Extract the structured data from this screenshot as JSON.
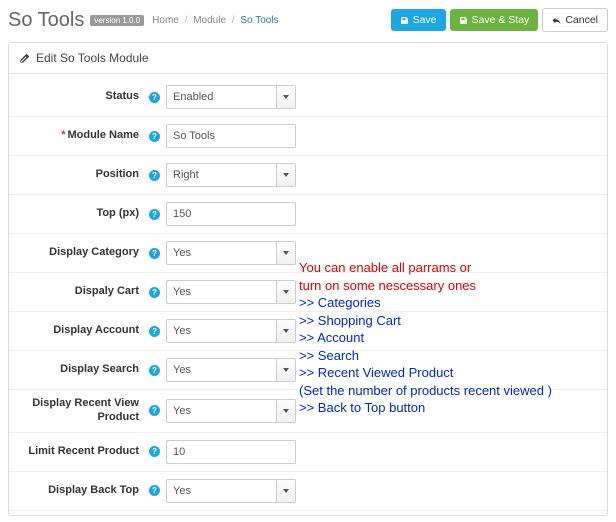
{
  "header": {
    "title": "So Tools",
    "version": "version 1.0.0",
    "breadcrumb": {
      "home": "Home",
      "module": "Module",
      "current": "So Tools"
    },
    "buttons": {
      "save": "Save",
      "save_stay": "Save & Stay",
      "cancel": "Cancel"
    }
  },
  "panel": {
    "title": "Edit So Tools Module"
  },
  "fields": {
    "status": {
      "label": "Status",
      "value": "Enabled"
    },
    "module_name": {
      "label": "Module Name",
      "value": "So Tools"
    },
    "position": {
      "label": "Position",
      "value": "Right"
    },
    "top": {
      "label": "Top (px)",
      "value": "150"
    },
    "display_category": {
      "label": "Display Category",
      "value": "Yes"
    },
    "display_cart": {
      "label": "Dispaly Cart",
      "value": "Yes"
    },
    "display_account": {
      "label": "Display Account",
      "value": "Yes"
    },
    "display_search": {
      "label": "Display Search",
      "value": "Yes"
    },
    "display_recent": {
      "label": "Display Recent View Product",
      "value": "Yes"
    },
    "limit_recent": {
      "label": "Limit Recent Product",
      "value": "10"
    },
    "display_backtop": {
      "label": "Display Back Top",
      "value": "Yes"
    }
  },
  "annotation": {
    "l1": "You can enable all parrams or",
    "l2": "turn on some nescessary ones",
    "l3": ">> Categories",
    "l4": ">> Shopping Cart",
    "l5": ">> Account",
    "l6": ">> Search",
    "l7": ">> Recent Viewed Product",
    "l8": "(Set the number of products recent viewed )",
    "l9": ">> Back to Top button"
  }
}
